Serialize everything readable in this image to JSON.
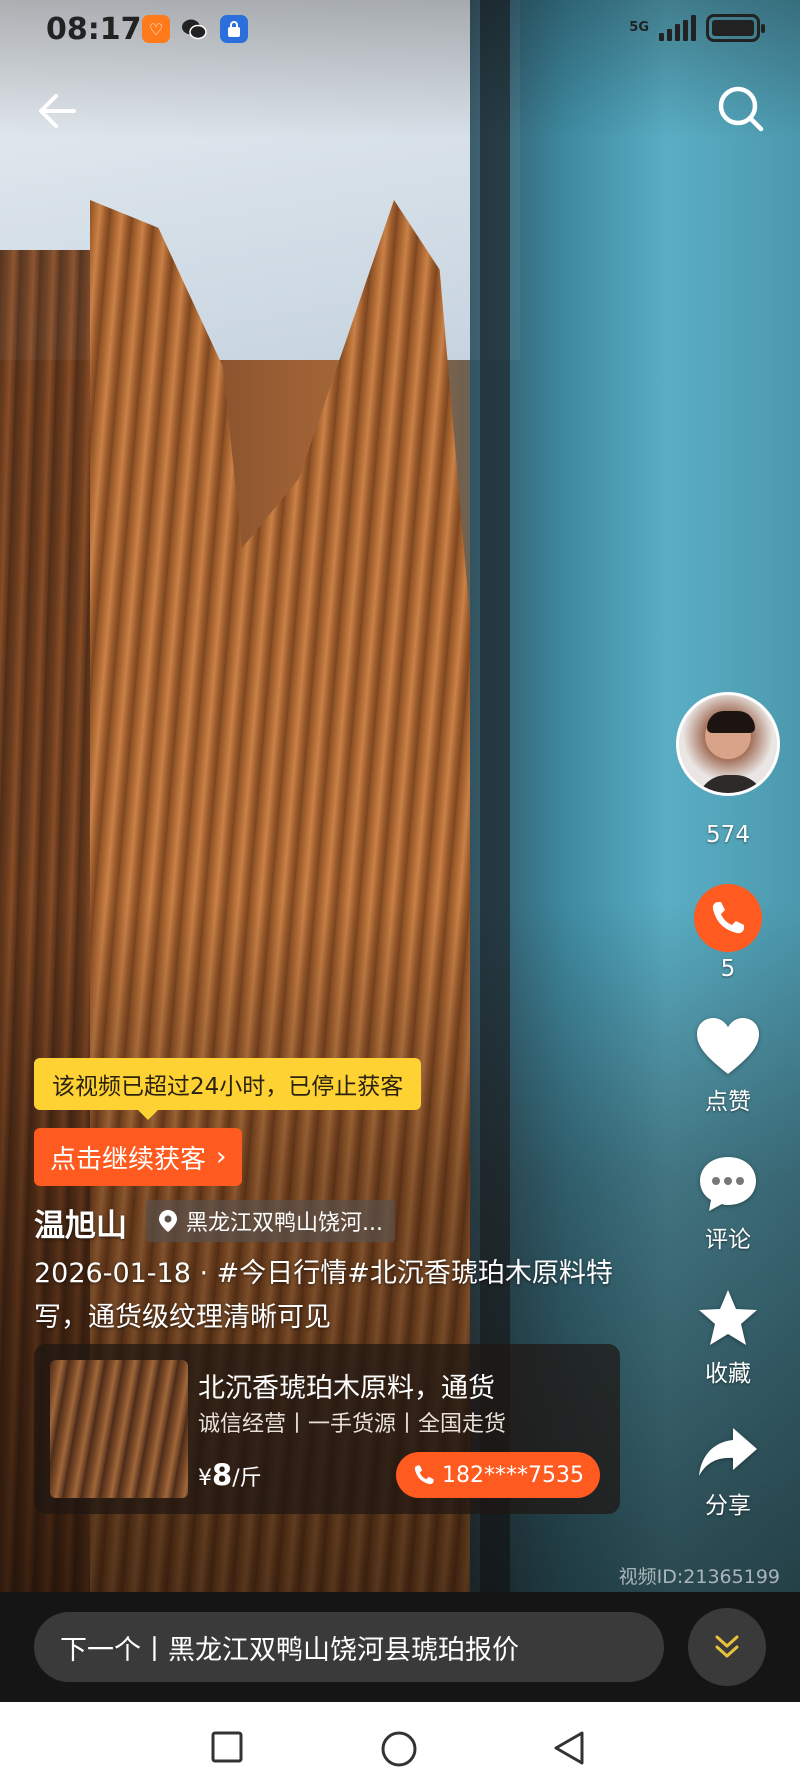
{
  "status_bar": {
    "time": "08:17",
    "network": "5G",
    "app_icons": [
      "taobao-icon",
      "wechat-icon",
      "security-icon"
    ],
    "battery_percent": 100
  },
  "nav": {
    "back_icon": "arrow-left-icon",
    "search_icon": "search-icon"
  },
  "rail": {
    "follower_count": "574",
    "call_count": "5",
    "like_label": "点赞",
    "comment_label": "评论",
    "favorite_label": "收藏",
    "share_label": "分享"
  },
  "notice": {
    "tip": "该视频已超过24小时，已停止获客",
    "continue_label": "点击继续获客",
    "continue_chevron": "›"
  },
  "post": {
    "author": "温旭山",
    "location": "黑龙江双鸭山饶河...",
    "description": "2026-01-18 · #今日行情#北沉香琥珀木原料特写，通货级纹理清晰可见"
  },
  "product": {
    "title": "北沉香琥珀木原料，通货",
    "tags": "诚信经营丨一手货源丨全国走货",
    "currency": "¥",
    "price": "8",
    "unit": "/斤",
    "phone": "182****7535"
  },
  "video_id": "视频ID:21365199",
  "next": {
    "label": "下一个丨黑龙江双鸭山饶河县琥珀报价"
  },
  "colors": {
    "accent_orange": "#ff5a1f",
    "tip_yellow": "#ffd233"
  }
}
